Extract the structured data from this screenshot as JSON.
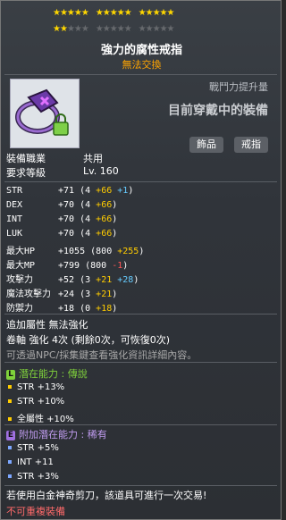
{
  "item": {
    "stars_row1": "★★★★★",
    "stars_row1b": "★★★★★",
    "stars_row1c": "★★★★★",
    "stars_row2_on": "★★",
    "stars_row2_off": "★★★",
    "stars_row2b_off": "★★★★★",
    "stars_row2c_off": "★★★★★",
    "name": "強力的腐性戒指",
    "trade": "無法交換",
    "combat_power_label": "戰鬥力提升量",
    "wearing_label": "目前穿戴中的裝備",
    "tag1": "飾品",
    "tag2": "戒指",
    "req_job_label": "裝備職業",
    "req_job_value": "共用",
    "req_level_label": "要求等級",
    "req_level_value": "Lv. 160"
  },
  "stats": [
    {
      "name": "STR",
      "total": "+71",
      "base": "4",
      "plus": "+66",
      "extra": "+1",
      "extra_color": "blue"
    },
    {
      "name": "DEX",
      "total": "+70",
      "base": "4",
      "plus": "+66",
      "extra": "",
      "extra_color": ""
    },
    {
      "name": "INT",
      "total": "+70",
      "base": "4",
      "plus": "+66",
      "extra": "",
      "extra_color": ""
    },
    {
      "name": "LUK",
      "total": "+70",
      "base": "4",
      "plus": "+66",
      "extra": "",
      "extra_color": ""
    },
    {
      "name": "最大HP",
      "total": "+1055",
      "base": "800",
      "plus": "+255",
      "extra": "",
      "extra_color": ""
    },
    {
      "name": "最大MP",
      "total": "+799",
      "base": "800",
      "plus": "-1",
      "extra": "",
      "extra_color": "red"
    },
    {
      "name": "攻擊力",
      "total": "+52",
      "base": "3",
      "plus": "+21",
      "extra": "+28",
      "extra_color": "blue"
    },
    {
      "name": "魔法攻擊力",
      "total": "+24",
      "base": "3",
      "plus": "+21",
      "extra": "",
      "extra_color": ""
    },
    {
      "name": "防禦力",
      "total": "+18",
      "base": "0",
      "plus": "+18",
      "extra": "",
      "extra_color": ""
    }
  ],
  "misc": {
    "additional_attr": "追加屬性 無法強化",
    "scroll_line": "卷軸 強化 4次 (剩餘0次，可恢復0次)",
    "hint": "可透過NPC/採集鍵查看強化資訊詳細內容。"
  },
  "potential": {
    "badge": "L",
    "label": "潛在能力 : 傳說",
    "lines": [
      "STR +13%",
      "STR +10%",
      "全屬性 +10%"
    ],
    "color": "#7fd13b"
  },
  "bonus_potential": {
    "badge": "E",
    "label": "附加潛在能力 : 稀有",
    "lines": [
      "STR +5%",
      "INT +11",
      "STR +3%"
    ],
    "color": "#a070e0"
  },
  "footer": {
    "note": "若使用白金神奇剪刀，該道具可進行一次交易!",
    "warn": "不可重複裝備"
  }
}
